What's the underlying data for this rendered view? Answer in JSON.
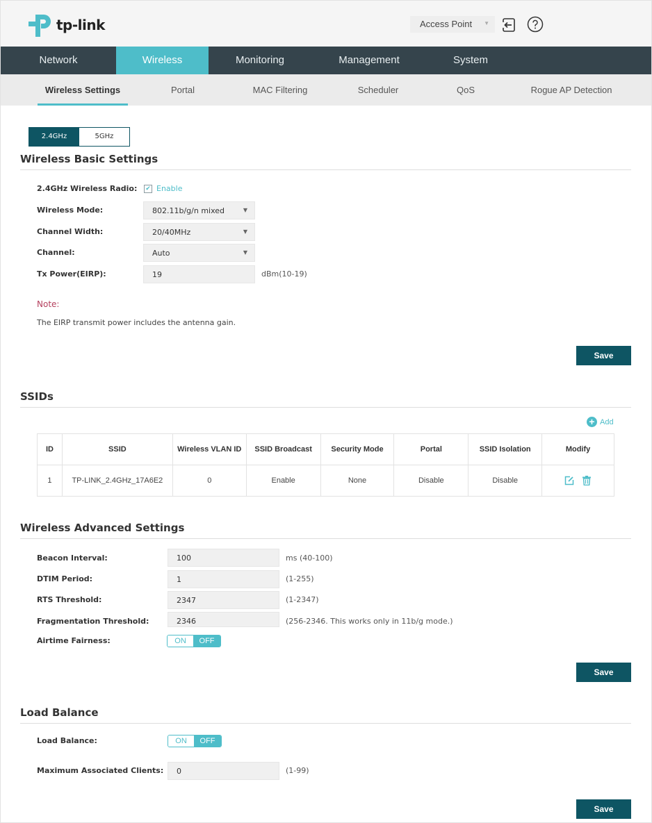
{
  "header": {
    "brand": "tp-link",
    "mode_select": {
      "value": "Access Point"
    },
    "icons": [
      "logout-icon",
      "help-icon"
    ]
  },
  "main_nav": [
    {
      "label": "Network",
      "active": false
    },
    {
      "label": "Wireless",
      "active": true
    },
    {
      "label": "Monitoring",
      "active": false
    },
    {
      "label": "Management",
      "active": false
    },
    {
      "label": "System",
      "active": false
    }
  ],
  "sub_nav": [
    {
      "label": "Wireless Settings",
      "active": true
    },
    {
      "label": "Portal",
      "active": false
    },
    {
      "label": "MAC Filtering",
      "active": false
    },
    {
      "label": "Scheduler",
      "active": false
    },
    {
      "label": "QoS",
      "active": false
    },
    {
      "label": "Rogue AP Detection",
      "active": false
    }
  ],
  "band_toggle": [
    {
      "label": "2.4GHz",
      "active": true
    },
    {
      "label": "5GHz",
      "active": false
    }
  ],
  "basic": {
    "title": "Wireless Basic Settings",
    "radio_label": "2.4GHz Wireless Radio:",
    "radio_enable_label": "Enable",
    "radio_enabled": true,
    "mode_label": "Wireless Mode:",
    "mode_value": "802.11b/g/n mixed",
    "width_label": "Channel Width:",
    "width_value": "20/40MHz",
    "channel_label": "Channel:",
    "channel_value": "Auto",
    "tx_label": "Tx Power(EIRP):",
    "tx_value": "19",
    "tx_hint": "dBm(10-19)",
    "note_title": "Note:",
    "note_text": "The EIRP transmit power includes the antenna gain.",
    "save_label": "Save"
  },
  "ssids": {
    "title": "SSIDs",
    "add_label": "Add",
    "columns": [
      "ID",
      "SSID",
      "Wireless VLAN ID",
      "SSID Broadcast",
      "Security Mode",
      "Portal",
      "SSID Isolation",
      "Modify"
    ],
    "rows": [
      {
        "id": "1",
        "ssid": "TP-LINK_2.4GHz_17A6E2",
        "vlan": "0",
        "broadcast": "Enable",
        "security": "None",
        "portal": "Disable",
        "isolation": "Disable"
      }
    ]
  },
  "advanced": {
    "title": "Wireless Advanced Settings",
    "beacon_label": "Beacon Interval:",
    "beacon_value": "100",
    "beacon_hint": "ms (40-100)",
    "dtim_label": "DTIM Period:",
    "dtim_value": "1",
    "dtim_hint": "(1-255)",
    "rts_label": "RTS Threshold:",
    "rts_value": "2347",
    "rts_hint": "(1-2347)",
    "frag_label": "Fragmentation Threshold:",
    "frag_value": "2346",
    "frag_hint": "(256-2346. This works only in 11b/g mode.)",
    "airtime_label": "Airtime Fairness:",
    "airtime_on_label": "ON",
    "airtime_off_label": "OFF",
    "airtime_state": "OFF",
    "save_label": "Save"
  },
  "load_balance": {
    "title": "Load Balance",
    "lb_label": "Load Balance:",
    "lb_on_label": "ON",
    "lb_off_label": "OFF",
    "lb_state": "OFF",
    "max_label": "Maximum Associated Clients:",
    "max_value": "0",
    "max_hint": "(1-99)",
    "save_label": "Save"
  },
  "colors": {
    "accent": "#4ebdc9",
    "primary_dark": "#0e5563",
    "nav_bg": "#35444c",
    "note_red": "#b5405e"
  }
}
